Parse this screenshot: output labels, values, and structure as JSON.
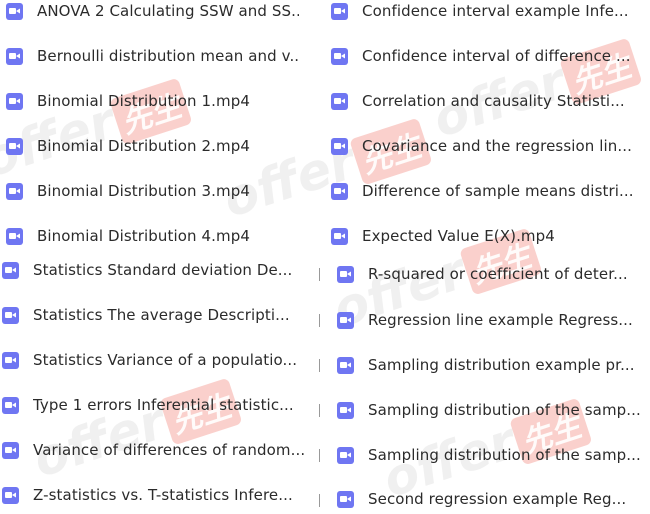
{
  "watermark": {
    "text": "offer",
    "tag": "先生"
  },
  "colors": {
    "icon": "#6f76f2"
  },
  "files_left": [
    "ANOVA 2  Calculating SSW and SS...",
    "Bernoulli distribution mean and v...",
    "Binomial Distribution 1.mp4",
    "Binomial Distribution 2.mp4",
    "Binomial Distribution 3.mp4",
    "Binomial Distribution 4.mp4",
    "Statistics  Standard deviation   De...",
    "Statistics  The average   Descripti...",
    "Statistics  Variance of a populatio...",
    "Type 1 errors   Inferential statistic...",
    "Variance of differences of random...",
    "Z-statistics vs. T-statistics   Infere..."
  ],
  "files_right": [
    "Confidence interval example   Infe...",
    "Confidence interval of difference ...",
    "Correlation and causality   Statisti...",
    "Covariance and the regression lin...",
    "Difference of sample means distri...",
    "Expected Value  E(X).mp4",
    "R-squared or coefficient of deter...",
    "Regression line example   Regress...",
    "Sampling distribution example pr...",
    "Sampling distribution of the samp...",
    "Sampling distribution of the samp...",
    "Second regression example   Reg..."
  ]
}
